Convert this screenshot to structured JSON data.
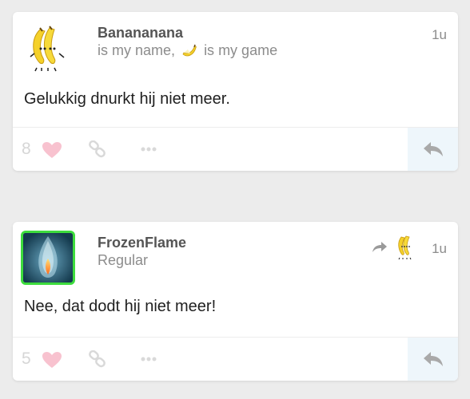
{
  "posts": [
    {
      "username": "Banananana",
      "subtitle_before": "is my name,",
      "subtitle_after": "is my game",
      "time": "1u",
      "body": "Gelukkig dnurkt hij niet meer.",
      "likes": "8",
      "avatar_icon": "dancing-banana-icon"
    },
    {
      "username": "FrozenFlame",
      "subtitle": "Regular",
      "time": "1u",
      "body": "Nee, dat dodt hij niet meer!",
      "likes": "5",
      "avatar_icon": "frozen-flame-avatar",
      "reply_to_icon": "dancing-banana-icon"
    }
  ],
  "colors": {
    "accent_heart": "#f8c2cf",
    "avatar_border": "#3ddc3d",
    "reply_bg": "#eef6fb"
  }
}
